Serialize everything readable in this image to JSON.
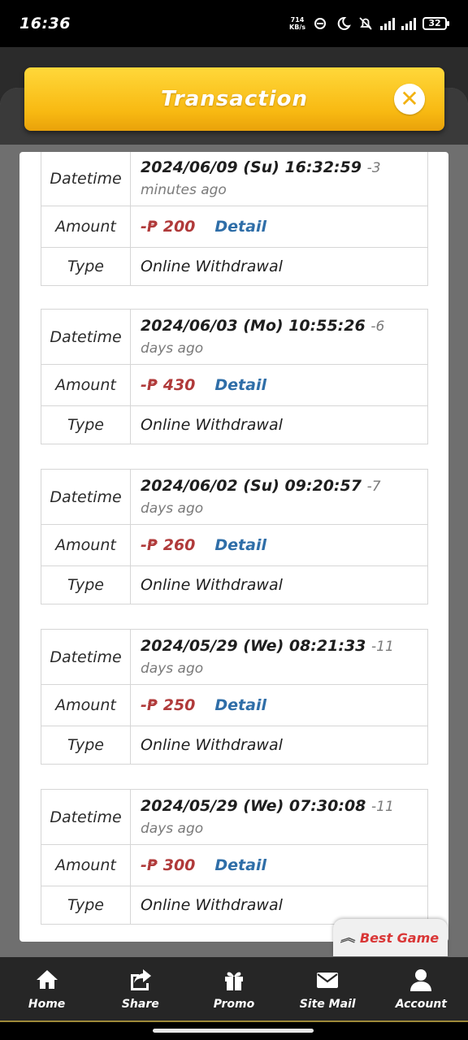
{
  "status_bar": {
    "time": "16:36",
    "net_speed_value": "714",
    "net_speed_unit": "KB/s",
    "battery": "32"
  },
  "header": {
    "title": "Transaction",
    "close_icon": "close-icon"
  },
  "labels": {
    "datetime": "Datetime",
    "amount": "Amount",
    "type": "Type",
    "detail": "Detail"
  },
  "transactions": [
    {
      "datetime": "2024/06/09 (Su) 16:32:59",
      "relative": "-3 minutes ago",
      "amount": "-₱ 200",
      "type": "Online Withdrawal"
    },
    {
      "datetime": "2024/06/03 (Mo) 10:55:26",
      "relative": "-6 days ago",
      "amount": "-₱ 430",
      "type": "Online Withdrawal"
    },
    {
      "datetime": "2024/06/02 (Su) 09:20:57",
      "relative": "-7 days ago",
      "amount": "-₱ 260",
      "type": "Online Withdrawal"
    },
    {
      "datetime": "2024/05/29 (We) 08:21:33",
      "relative": "-11 days ago",
      "amount": "-₱ 250",
      "type": "Online Withdrawal"
    },
    {
      "datetime": "2024/05/29 (We) 07:30:08",
      "relative": "-11 days ago",
      "amount": "-₱ 300",
      "type": "Online Withdrawal"
    }
  ],
  "best_game": {
    "label": "Best Game",
    "icon": "double-chevron-up-icon"
  },
  "nav": {
    "items": [
      {
        "label": "Home",
        "icon": "home-icon"
      },
      {
        "label": "Share",
        "icon": "share-icon"
      },
      {
        "label": "Promo",
        "icon": "gift-icon"
      },
      {
        "label": "Site Mail",
        "icon": "mail-icon"
      },
      {
        "label": "Account",
        "icon": "account-icon"
      }
    ]
  },
  "colors": {
    "header_yellow": "#f8b912",
    "amount_red": "#b03a3a",
    "detail_blue": "#2f6ea8",
    "best_game_red": "#d93636"
  }
}
